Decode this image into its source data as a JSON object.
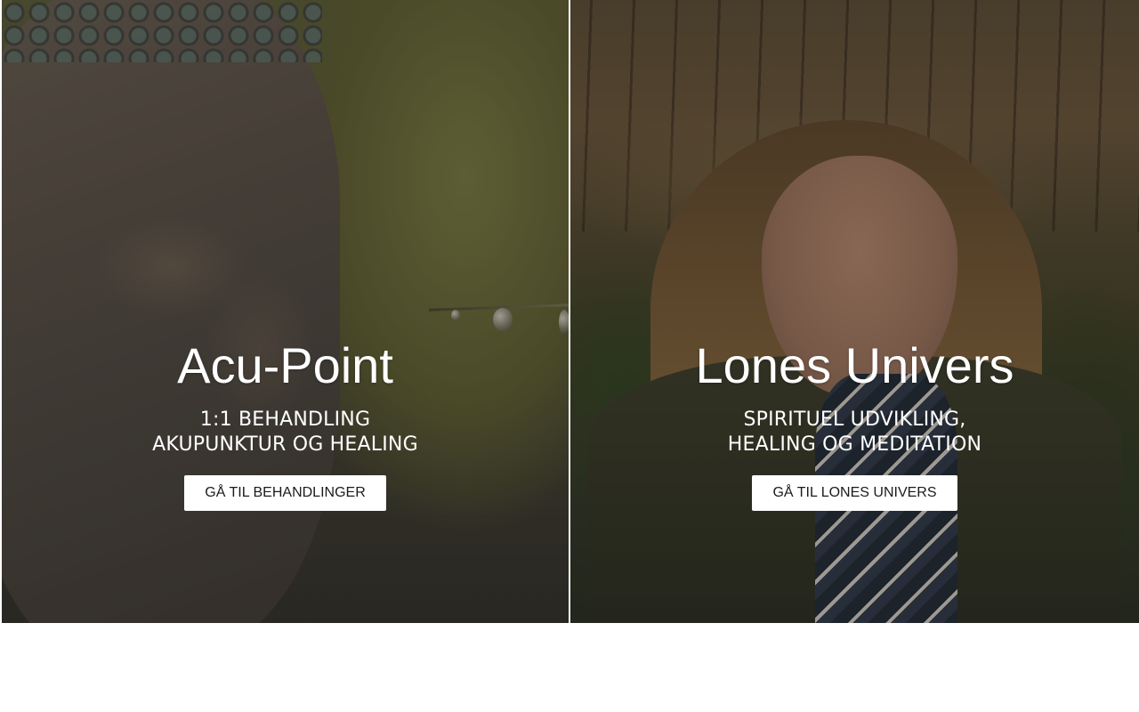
{
  "left_panel": {
    "title": "Acu-Point",
    "subtitle_line1": "1:1 BEHANDLING",
    "subtitle_line2": "AKUPUNKTUR OG HEALING",
    "button_label": "GÅ TIL BEHANDLINGER"
  },
  "right_panel": {
    "title": "Lones Univers",
    "subtitle_line1": "SPIRITUEL UDVIKLING,",
    "subtitle_line2": "HEALING OG MEDITATION",
    "button_label": "GÅ TIL LONES UNIVERS"
  },
  "colors": {
    "overlay": "#000000",
    "text": "#ffffff",
    "button_bg": "#ffffff",
    "button_text": "#1b1b1b",
    "page_bg": "#ffffff"
  }
}
